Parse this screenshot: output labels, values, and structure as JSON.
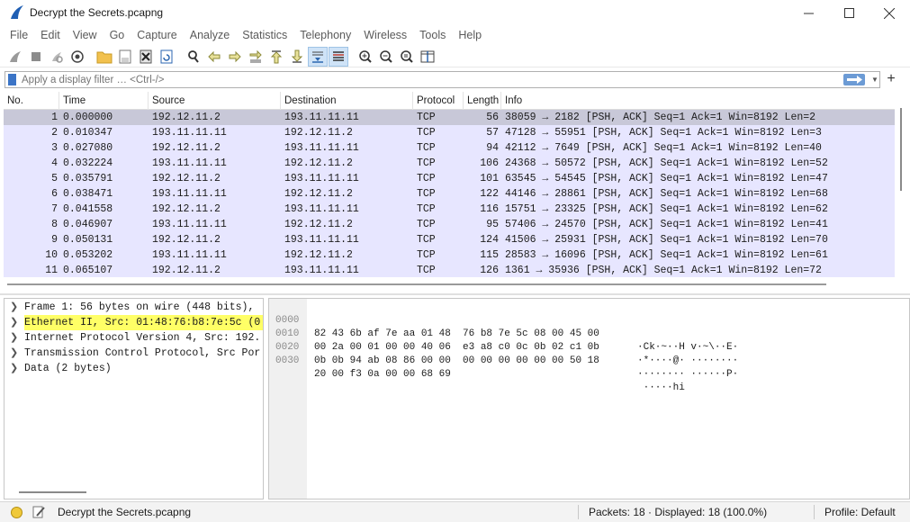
{
  "window": {
    "title": "Decrypt the Secrets.pcapng"
  },
  "menu": [
    "File",
    "Edit",
    "View",
    "Go",
    "Capture",
    "Analyze",
    "Statistics",
    "Telephony",
    "Wireless",
    "Tools",
    "Help"
  ],
  "toolbar": {
    "icons": [
      "shark-fin-start-icon",
      "stop-capture-icon",
      "restart-capture-icon",
      "capture-options-icon",
      "open-file-icon",
      "save-file-icon",
      "close-file-icon",
      "reload-file-icon",
      "find-packet-icon",
      "go-back-icon",
      "go-forward-icon",
      "go-to-packet-icon",
      "go-first-icon",
      "go-last-icon",
      "autoscroll-icon",
      "colorize-icon",
      "zoom-in-icon",
      "zoom-out-icon",
      "normal-size-icon",
      "resize-columns-icon"
    ]
  },
  "filter": {
    "placeholder": "Apply a display filter … <Ctrl-/>"
  },
  "packet_list": {
    "columns": [
      "No.",
      "Time",
      "Source",
      "Destination",
      "Protocol",
      "Length",
      "Info"
    ],
    "rows": [
      {
        "no": "1",
        "time": "0.000000",
        "src": "192.12.11.2",
        "dst": "193.11.11.11",
        "proto": "TCP",
        "len": "56",
        "info": "38059 → 2182 [PSH, ACK] Seq=1 Ack=1 Win=8192 Len=2"
      },
      {
        "no": "2",
        "time": "0.010347",
        "src": "193.11.11.11",
        "dst": "192.12.11.2",
        "proto": "TCP",
        "len": "57",
        "info": "47128 → 55951 [PSH, ACK] Seq=1 Ack=1 Win=8192 Len=3"
      },
      {
        "no": "3",
        "time": "0.027080",
        "src": "192.12.11.2",
        "dst": "193.11.11.11",
        "proto": "TCP",
        "len": "94",
        "info": "42112 → 7649 [PSH, ACK] Seq=1 Ack=1 Win=8192 Len=40"
      },
      {
        "no": "4",
        "time": "0.032224",
        "src": "193.11.11.11",
        "dst": "192.12.11.2",
        "proto": "TCP",
        "len": "106",
        "info": "24368 → 50572 [PSH, ACK] Seq=1 Ack=1 Win=8192 Len=52"
      },
      {
        "no": "5",
        "time": "0.035791",
        "src": "192.12.11.2",
        "dst": "193.11.11.11",
        "proto": "TCP",
        "len": "101",
        "info": "63545 → 54545 [PSH, ACK] Seq=1 Ack=1 Win=8192 Len=47"
      },
      {
        "no": "6",
        "time": "0.038471",
        "src": "193.11.11.11",
        "dst": "192.12.11.2",
        "proto": "TCP",
        "len": "122",
        "info": "44146 → 28861 [PSH, ACK] Seq=1 Ack=1 Win=8192 Len=68"
      },
      {
        "no": "7",
        "time": "0.041558",
        "src": "192.12.11.2",
        "dst": "193.11.11.11",
        "proto": "TCP",
        "len": "116",
        "info": "15751 → 23325 [PSH, ACK] Seq=1 Ack=1 Win=8192 Len=62"
      },
      {
        "no": "8",
        "time": "0.046907",
        "src": "193.11.11.11",
        "dst": "192.12.11.2",
        "proto": "TCP",
        "len": "95",
        "info": "57406 → 24570 [PSH, ACK] Seq=1 Ack=1 Win=8192 Len=41"
      },
      {
        "no": "9",
        "time": "0.050131",
        "src": "192.12.11.2",
        "dst": "193.11.11.11",
        "proto": "TCP",
        "len": "124",
        "info": "41506 → 25931 [PSH, ACK] Seq=1 Ack=1 Win=8192 Len=70"
      },
      {
        "no": "10",
        "time": "0.053202",
        "src": "193.11.11.11",
        "dst": "192.12.11.2",
        "proto": "TCP",
        "len": "115",
        "info": "28583 → 16096 [PSH, ACK] Seq=1 Ack=1 Win=8192 Len=61"
      },
      {
        "no": "11",
        "time": "0.065107",
        "src": "192.12.11.2",
        "dst": "193.11.11.11",
        "proto": "TCP",
        "len": "126",
        "info": "1361 → 35936 [PSH, ACK] Seq=1 Ack=1 Win=8192 Len=72"
      }
    ]
  },
  "detail_tree": [
    "Frame 1: 56 bytes on wire (448 bits),",
    "Ethernet II, Src: 01:48:76:b8:7e:5c (0",
    "Internet Protocol Version 4, Src: 192.",
    "Transmission Control Protocol, Src Por",
    "Data (2 bytes)"
  ],
  "bytes": [
    {
      "off": "0000",
      "hex": "82 43 6b af 7e aa 01 48  76 b8 7e 5c 08 00 45 00",
      "ascii": "·Ck·~··H v·~\\··E·"
    },
    {
      "off": "0010",
      "hex": "00 2a 00 01 00 00 40 06  e3 a8 c0 0c 0b 02 c1 0b",
      "ascii": "·*····@· ········"
    },
    {
      "off": "0020",
      "hex": "0b 0b 94 ab 08 86 00 00  00 00 00 00 00 00 50 18",
      "ascii": "········ ······P·"
    },
    {
      "off": "0030",
      "hex": "20 00 f3 0a 00 00 68 69",
      "ascii": " ·····hi"
    }
  ],
  "status": {
    "file": "Decrypt the Secrets.pcapng",
    "packets": "Packets: 18 · Displayed: 18 (100.0%)",
    "profile": "Profile: Default"
  }
}
